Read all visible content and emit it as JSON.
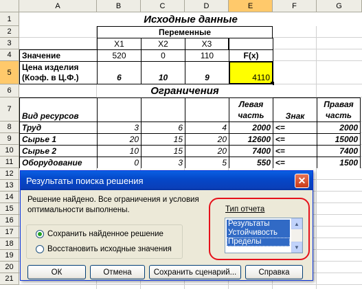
{
  "columns": [
    "A",
    "B",
    "C",
    "D",
    "E",
    "F",
    "G"
  ],
  "rows": [
    "1",
    "2",
    "3",
    "4",
    "5",
    "6",
    "7",
    "8",
    "9",
    "10",
    "11",
    "12",
    "13",
    "14",
    "15",
    "16",
    "17",
    "18",
    "19",
    "20",
    "21"
  ],
  "selected_cell": {
    "column": "E",
    "row": "5"
  },
  "sheet": {
    "title_1": "Исходные данные",
    "vars_header": "Переменные",
    "x1": "X1",
    "x2": "X2",
    "x3": "X3",
    "value_label": "Значение",
    "v1": "520",
    "v2": "0",
    "v3": "110",
    "fx": "F(x)",
    "price_label_1": "Цена изделия",
    "price_label_2": "(Коэф. в Ц.Ф.)",
    "p1": "6",
    "p2": "10",
    "p3": "9",
    "e5_value": "4110",
    "title_2": "Ограничения",
    "res_kind": "Вид ресурсов",
    "left_1": "Левая",
    "left_2": "часть",
    "sign": "Знак",
    "right_1": "Правая",
    "right_2": "часть",
    "table": [
      {
        "name": "Труд",
        "b": "3",
        "c": "6",
        "d": "4",
        "e": "2000",
        "f": "<=",
        "g": "2000"
      },
      {
        "name": "Сырье 1",
        "b": "20",
        "c": "15",
        "d": "20",
        "e": "12600",
        "f": "<=",
        "g": "15000"
      },
      {
        "name": "Сырье 2",
        "b": "10",
        "c": "15",
        "d": "20",
        "e": "7400",
        "f": "<=",
        "g": "7400"
      },
      {
        "name": "Оборудование",
        "b": "0",
        "c": "3",
        "d": "5",
        "e": "550",
        "f": "<=",
        "g": "1500"
      }
    ]
  },
  "dialog": {
    "title": "Результаты поиска решения",
    "message_1": "Решение найдено. Все ограничения и условия",
    "message_2": "оптимальности выполнены.",
    "report_type": "Тип отчета",
    "reports": [
      "Результаты",
      "Устойчивость",
      "Пределы"
    ],
    "radio_keep": "Сохранить найденное решение",
    "radio_restore": "Восстановить исходные значения",
    "radio_keep_checked": true,
    "btn_ok": "ОК",
    "btn_cancel": "Отмена",
    "btn_save": "Сохранить сценарий...",
    "btn_help": "Справка"
  },
  "colors": {
    "selected_cell_fill": "#ffff00",
    "highlight_outline": "#e6101a",
    "titlebar": "#0548c9"
  }
}
